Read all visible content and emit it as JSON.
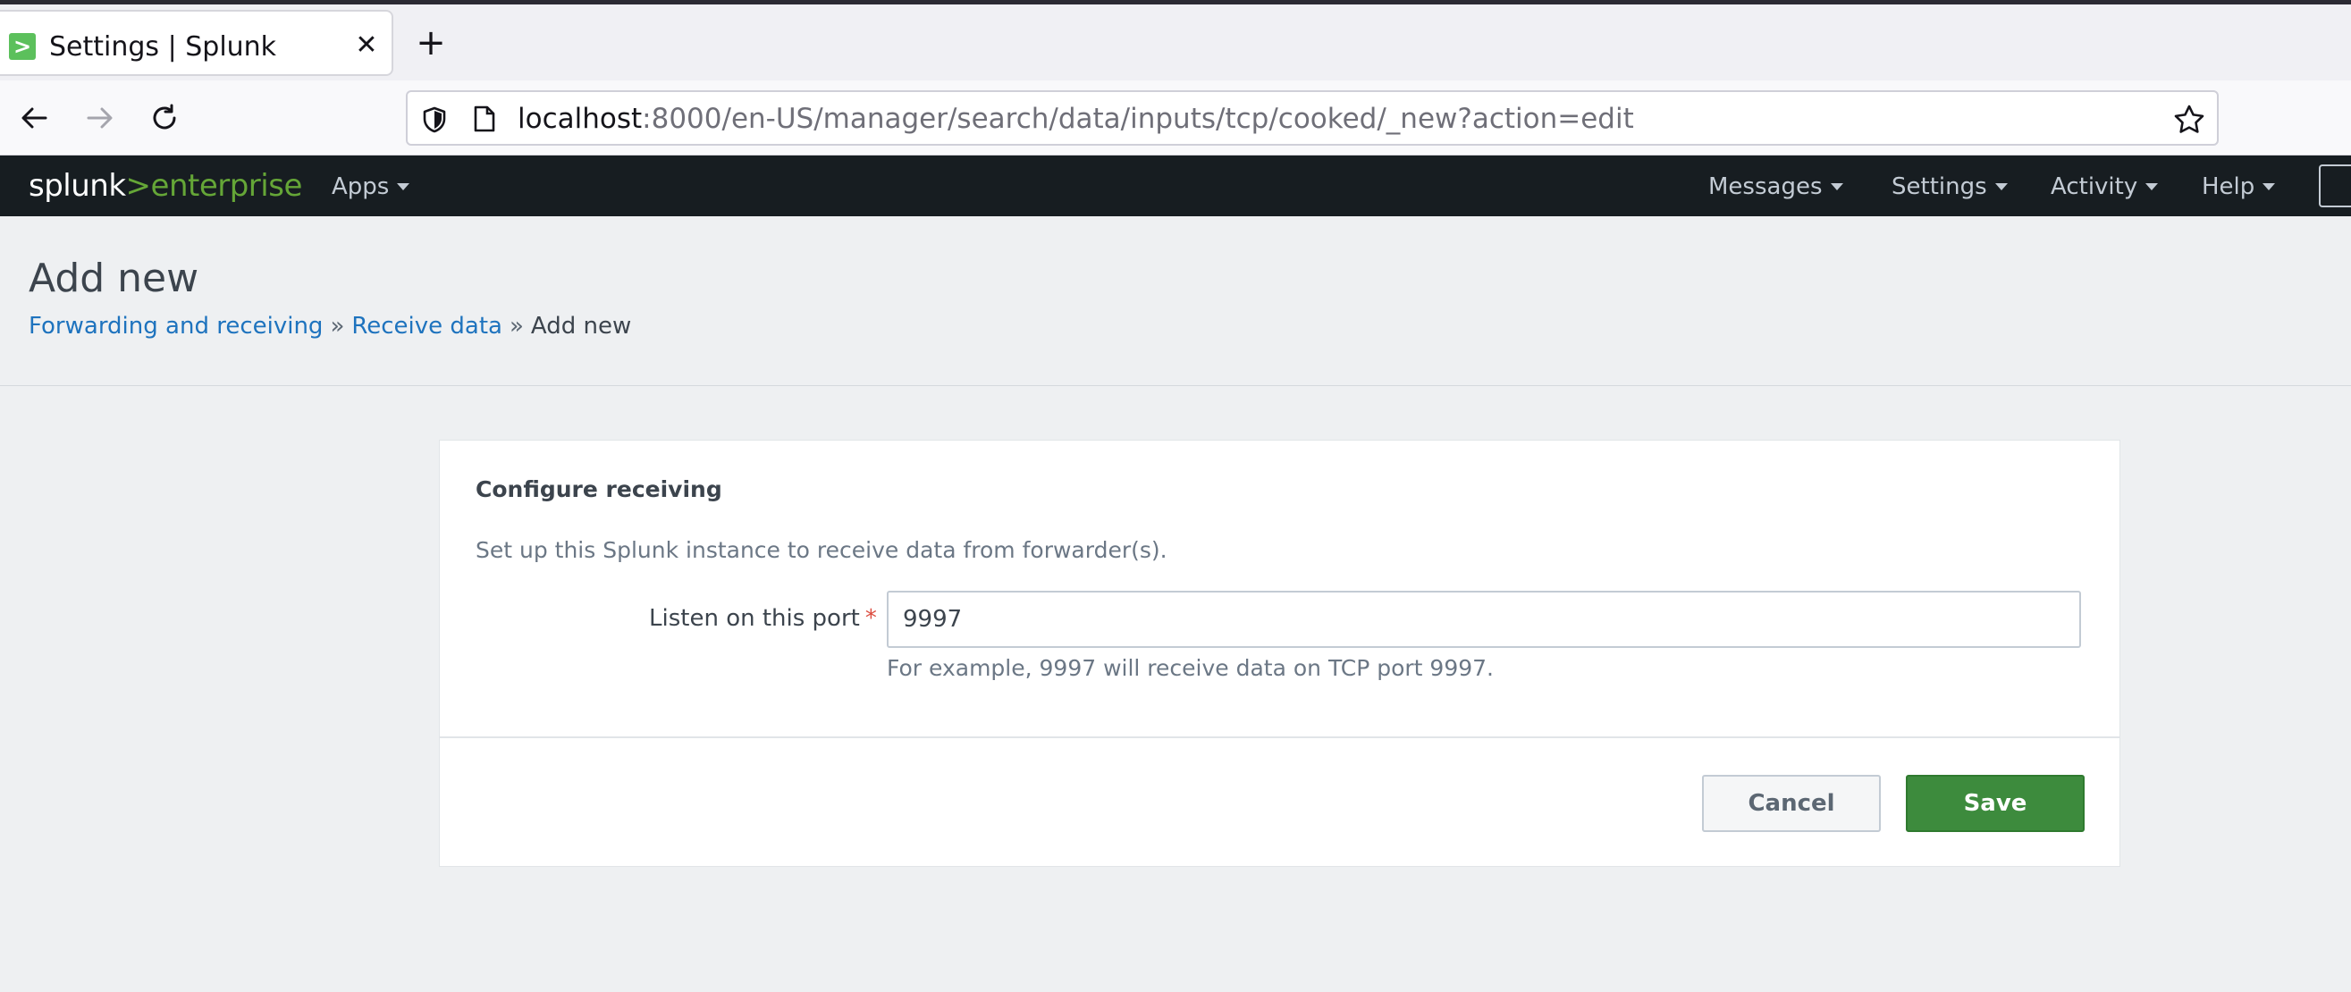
{
  "browser": {
    "tab": {
      "title": "Settings | Splunk",
      "close_glyph": "✕"
    },
    "new_tab_glyph": "+",
    "url": {
      "host": "localhost",
      "rest": ":8000/en-US/manager/search/data/inputs/tcp/cooked/_new?action=edit"
    }
  },
  "header": {
    "logo": {
      "brand": "splunk",
      "separator": ">",
      "product": "enterprise"
    },
    "menus": {
      "apps": "Apps",
      "messages": "Messages",
      "settings": "Settings",
      "activity": "Activity",
      "help": "Help"
    }
  },
  "page": {
    "title": "Add new",
    "breadcrumb": {
      "items": [
        "Forwarding and receiving",
        "Receive data"
      ],
      "separator": "»",
      "current": "Add new"
    }
  },
  "form": {
    "section_title": "Configure receiving",
    "description": "Set up this Splunk instance to receive data from forwarder(s).",
    "port_field": {
      "label": "Listen on this port",
      "required_mark": "*",
      "value": "9997",
      "help": "For example, 9997 will receive data on TCP port 9997."
    },
    "buttons": {
      "cancel": "Cancel",
      "save": "Save"
    }
  },
  "colors": {
    "splunk_header_bg": "#171d21",
    "splunk_green": "#65a637",
    "link_blue": "#1e73be",
    "save_button": "#3d8b3d",
    "required_red": "#dc4e41"
  }
}
